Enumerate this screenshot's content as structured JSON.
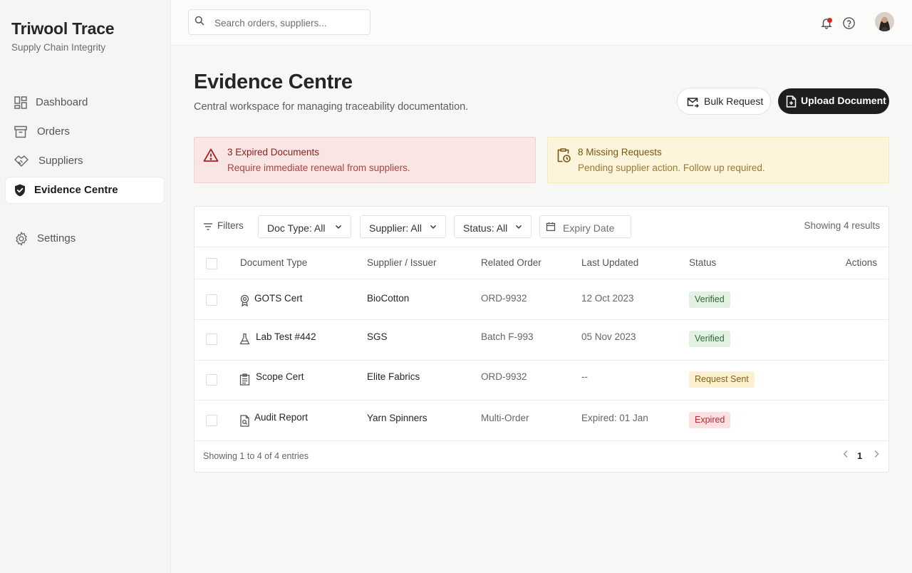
{
  "app": {
    "brand_title": "Triwool Trace",
    "brand_subtitle": "Supply Chain Integrity"
  },
  "sidebar": {
    "items": [
      {
        "label": "Dashboard",
        "icon": "dashboard-icon"
      },
      {
        "label": "Orders",
        "icon": "archive-box-icon"
      },
      {
        "label": "Suppliers",
        "icon": "handshake-icon"
      },
      {
        "label": "Evidence Centre",
        "icon": "shield-check-icon",
        "active": true
      },
      {
        "label": "Settings",
        "icon": "gear-icon"
      }
    ]
  },
  "topbar": {
    "search_placeholder": "Search orders, suppliers..."
  },
  "page": {
    "title": "Evidence Centre",
    "subtitle": "Central workspace for managing traceability documentation.",
    "bulk_request_label": "Bulk Request",
    "upload_label": "Upload Document"
  },
  "alerts": {
    "expired": {
      "title": "3 Expired Documents",
      "description": "Require immediate renewal from suppliers."
    },
    "missing": {
      "title": "8 Missing Requests",
      "description": "Pending supplier action. Follow up required."
    }
  },
  "filters": {
    "label": "Filters",
    "doc_type": "Doc Type: All",
    "supplier": "Supplier: All",
    "status": "Status: All",
    "expiry_placeholder": "Expiry Date",
    "results_text": "Showing 4 results"
  },
  "table": {
    "columns": [
      "Document Type",
      "Supplier / Issuer",
      "Related Order",
      "Last Updated",
      "Status",
      "Actions"
    ],
    "rows": [
      {
        "doc": "GOTS Cert",
        "icon": "award-badge-icon",
        "supplier": "BioCotton",
        "order": "ORD-9932",
        "updated": "12 Oct 2023",
        "status": "Verified"
      },
      {
        "doc": "Lab Test #442",
        "icon": "flask-icon",
        "supplier": "SGS",
        "order": "Batch F-993",
        "updated": "05 Nov 2023",
        "status": "Verified"
      },
      {
        "doc": "Scope Cert",
        "icon": "clipboard-icon",
        "supplier": "Elite Fabrics",
        "order": "ORD-9932",
        "updated": "--",
        "status": "Request Sent"
      },
      {
        "doc": "Audit Report",
        "icon": "document-search-icon",
        "supplier": "Yarn Spinners",
        "order": "Multi-Order",
        "updated": "Expired: 01 Jan",
        "status": "Expired"
      }
    ]
  },
  "footer": {
    "entries_text": "Showing 1 to 4 of 4 entries",
    "current_page": "1"
  },
  "colors": {
    "accent_dark": "#1e1e1e",
    "danger": "#b32929",
    "warning": "#8a6112",
    "success": "#2e6a34"
  }
}
